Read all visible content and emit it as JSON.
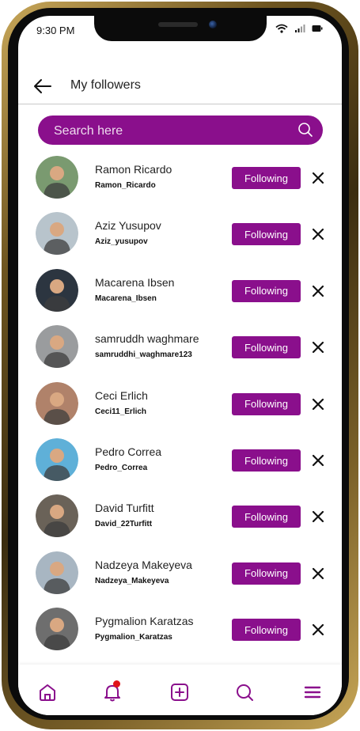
{
  "status_bar": {
    "time": "9:30 PM"
  },
  "header": {
    "title": "My followers"
  },
  "search": {
    "placeholder": "Search here"
  },
  "followers": [
    {
      "name": "Ramon Ricardo",
      "handle": "Ramon_Ricardo",
      "button": "Following",
      "avatar_color": "#7a9a70"
    },
    {
      "name": "Aziz Yusupov",
      "handle": "Aziz_yusupov",
      "button": "Following",
      "avatar_color": "#b8c4cc"
    },
    {
      "name": "Macarena Ibsen",
      "handle": "Macarena_Ibsen",
      "button": "Following",
      "avatar_color": "#2c3540"
    },
    {
      "name": "samruddh waghmare",
      "handle": "samruddhi_waghmare123",
      "button": "Following",
      "avatar_color": "#9a9c9e"
    },
    {
      "name": "Ceci Erlich",
      "handle": "Ceci11_Erlich",
      "button": "Following",
      "avatar_color": "#b0826a"
    },
    {
      "name": "Pedro Correa",
      "handle": "Pedro_Correa",
      "button": "Following",
      "avatar_color": "#5fb0d8"
    },
    {
      "name": "David Turfitt",
      "handle": "David_22Turfitt",
      "button": "Following",
      "avatar_color": "#6a6258"
    },
    {
      "name": "Nadzeya Makeyeva",
      "handle": "Nadzeya_Makeyeva",
      "button": "Following",
      "avatar_color": "#a8b6c2"
    },
    {
      "name": "Pygmalion Karatzas",
      "handle": "Pygmalion_Karatzas",
      "button": "Following",
      "avatar_color": "#6e6e6e"
    }
  ],
  "colors": {
    "accent": "#8a0f8c",
    "notification": "#e0131a"
  },
  "bottom_nav": [
    "home-icon",
    "bell-icon",
    "add-icon",
    "search-icon",
    "menu-icon"
  ]
}
